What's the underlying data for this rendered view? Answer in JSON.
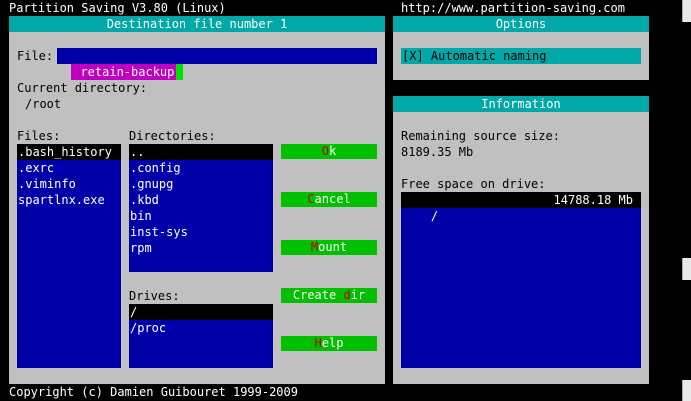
{
  "header": {
    "title": "Partition Saving V3.80 (Linux)",
    "url": "http://www.partition-saving.com"
  },
  "dialog": {
    "title": "Destination file number 1",
    "file_label": "File:",
    "file_value": "retain-backup",
    "current_dir_label": "Current directory:",
    "current_dir_value": "/root",
    "files_label": "Files:",
    "files": [
      ".bash_history",
      ".exrc",
      ".viminfo",
      "spartlnx.exe"
    ],
    "directories_label": "Directories:",
    "directories": [
      "..",
      ".config",
      ".gnupg",
      ".kbd",
      "bin",
      "inst-sys",
      "rpm"
    ],
    "drives_label": "Drives:",
    "drives": [
      "/",
      "/proc"
    ],
    "buttons": {
      "ok": {
        "pre": "",
        "hot": "O",
        "post": "k"
      },
      "cancel": {
        "pre": "",
        "hot": "C",
        "post": "ancel"
      },
      "mount": {
        "pre": "",
        "hot": "M",
        "post": "ount"
      },
      "create_dir": {
        "pre": "Create ",
        "hot": "d",
        "post": "ir"
      },
      "help": {
        "pre": "",
        "hot": "H",
        "post": "elp"
      }
    }
  },
  "options": {
    "title": "Options",
    "automatic_naming": "[X] Automatic naming"
  },
  "information": {
    "title": "Information",
    "remaining_label": "Remaining source size:",
    "remaining_value": "8189.35 Mb",
    "free_space_label": "Free space on drive:",
    "drive_row": {
      "name": "/",
      "space": "14788.18 Mb"
    }
  },
  "footer": {
    "copyright": "Copyright (c) Damien Guibouret 1999-2009"
  }
}
